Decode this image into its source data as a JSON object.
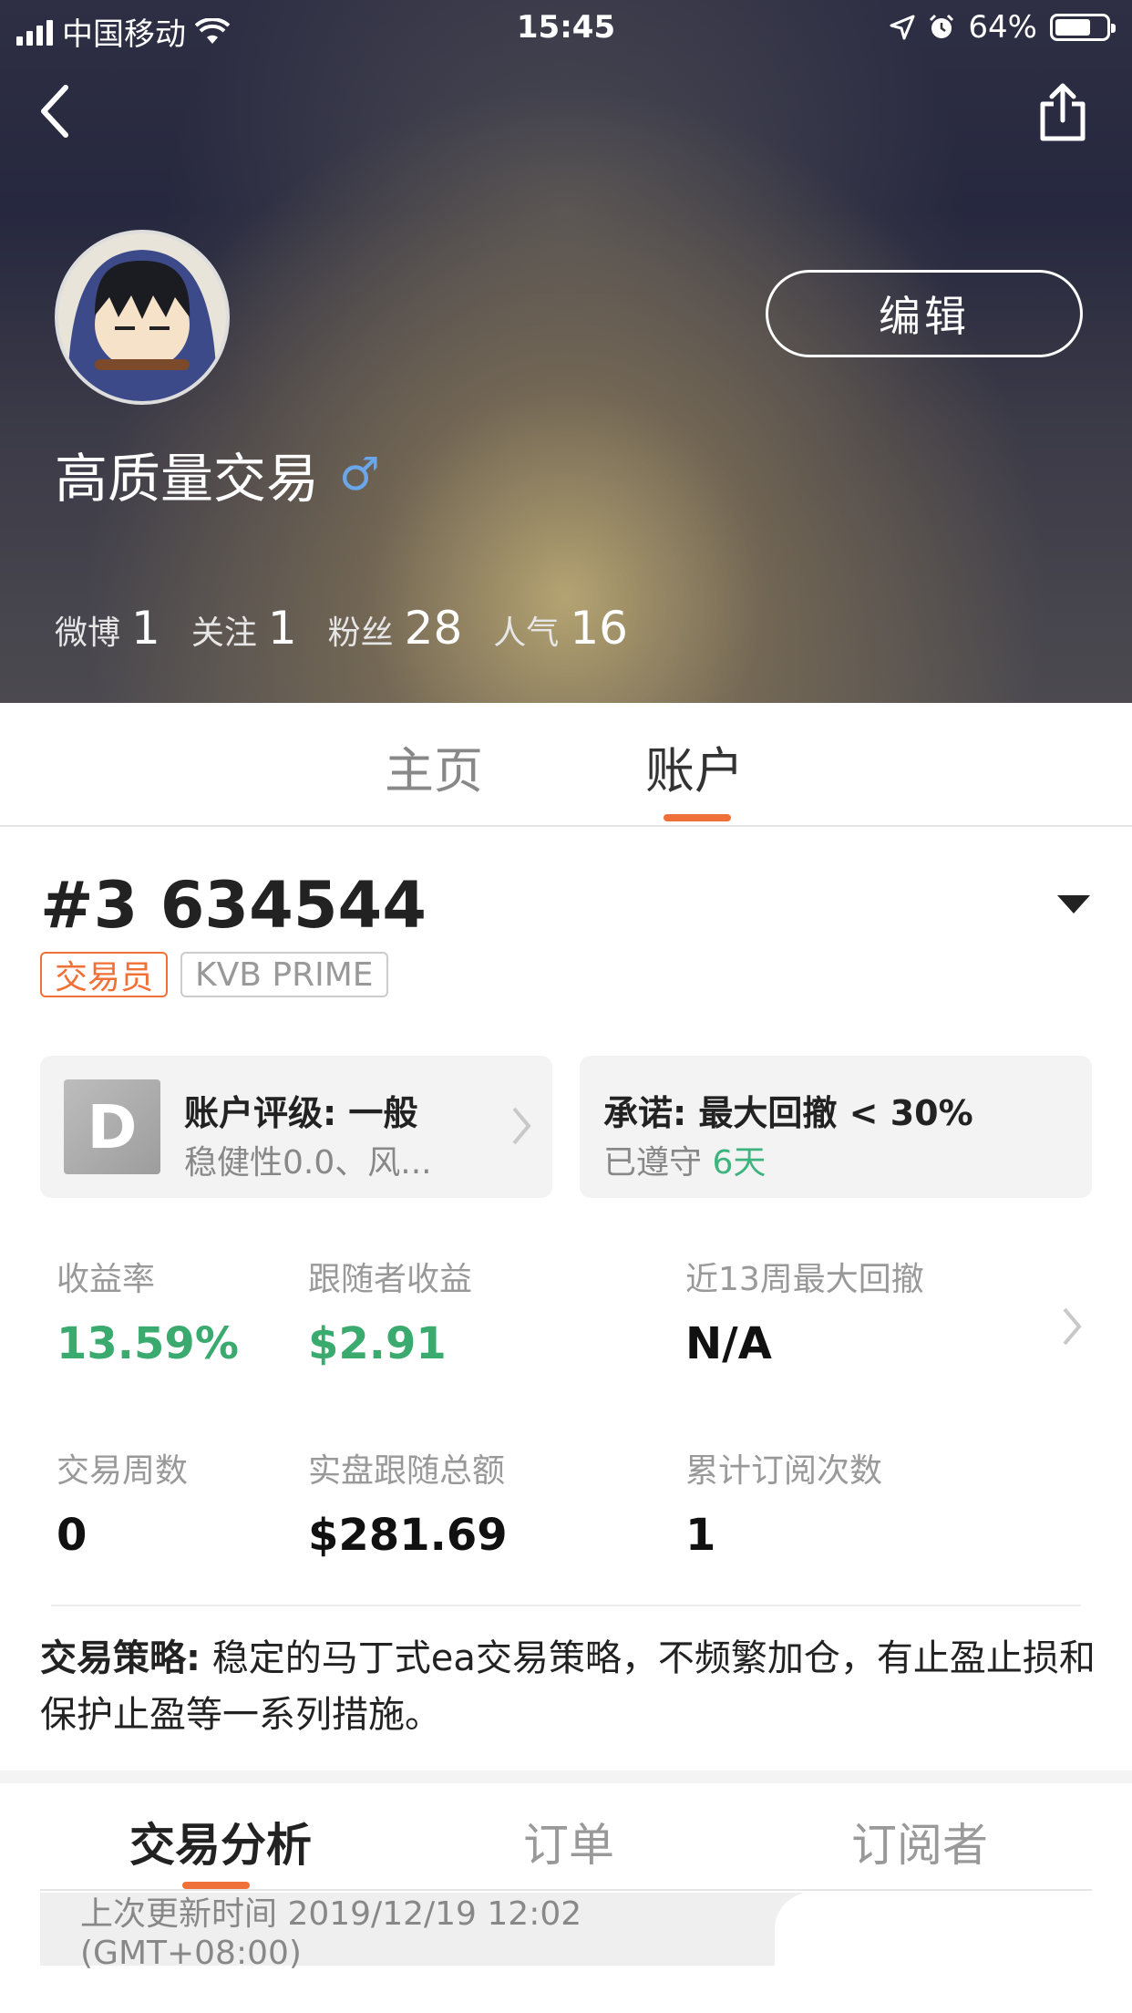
{
  "status_bar": {
    "carrier": "中国移动",
    "time": "15:45",
    "battery": "64%"
  },
  "profile": {
    "username": "高质量交易",
    "gender_symbol": "♂",
    "edit_label": "编辑",
    "stats": [
      {
        "label": "微博",
        "value": "1"
      },
      {
        "label": "关注",
        "value": "1"
      },
      {
        "label": "粉丝",
        "value": "28"
      },
      {
        "label": "人气",
        "value": "16"
      }
    ]
  },
  "tabs": {
    "home": "主页",
    "account": "账户",
    "active": "账户"
  },
  "account": {
    "title": "#3 634544",
    "badges": {
      "role": "交易员",
      "broker": "KVB PRIME"
    },
    "rating_card": {
      "grade": "D",
      "title": "账户评级: 一般",
      "subtitle": "稳健性0.0、风..."
    },
    "promise_card": {
      "title": "承诺: 最大回撤 < 30%",
      "subtitle_prefix": "已遵守",
      "days": "6天"
    },
    "metrics": [
      {
        "label": "收益率",
        "value": "13.59%"
      },
      {
        "label": "跟随者收益",
        "value": "$2.91"
      },
      {
        "label": "近13周最大回撤",
        "value": "N/A"
      },
      {
        "label": "交易周数",
        "value": "0"
      },
      {
        "label": "实盘跟随总额",
        "value": "$281.69"
      },
      {
        "label": "累计订阅次数",
        "value": "1"
      }
    ],
    "strategy": {
      "label": "交易策略:",
      "text": " 稳定的马丁式ea交易策略，不频繁加仓，有止盈止损和保护止盈等一系列措施。"
    }
  },
  "subtabs": {
    "analysis": "交易分析",
    "orders": "订单",
    "subscribers": "订阅者",
    "active": "交易分析"
  },
  "last_update": "上次更新时间 2019/12/19 12:02 (GMT+08:00)",
  "colors": {
    "accent": "#f0703a",
    "positive": "#3aaa6e",
    "promise_green": "#3db47d"
  }
}
